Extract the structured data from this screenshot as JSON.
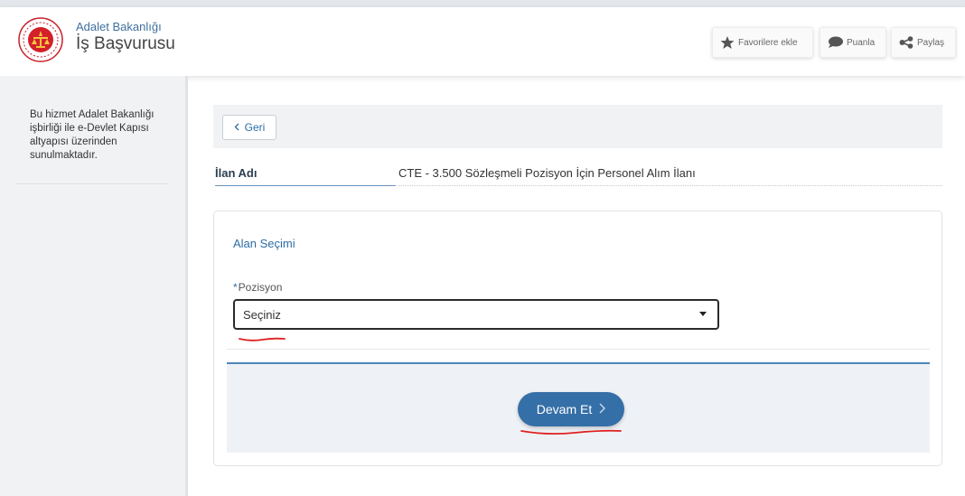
{
  "header": {
    "org_name": "Adalet Bakanlığı",
    "service_name": "İş Başvurusu",
    "buttons": {
      "favorite": "Favorilere ekle",
      "rate": "Puanla",
      "share": "Paylaş"
    }
  },
  "sidebar": {
    "info_text": "Bu hizmet Adalet Bakanlığı işbirliği ile e-Devlet Kapısı altyapısı üzerinden sunulmaktadır."
  },
  "nav": {
    "back_label": "Geri"
  },
  "listing": {
    "label": "İlan Adı",
    "value": "CTE - 3.500 Sözleşmeli Pozisyon İçin Personel Alım İlanı"
  },
  "form": {
    "section_title": "Alan Seçimi",
    "required_mark": "*",
    "position_label": "Pozisyon",
    "position_selected": "Seçiniz",
    "continue_label": "Devam Et"
  },
  "colors": {
    "accent": "#2e6da4",
    "button": "#356fa7",
    "annotation": "#e02020"
  },
  "icons": {
    "logo": "ministry-seal-icon",
    "favorite": "star-icon",
    "rate": "speech-bubble-icon",
    "share": "share-icon",
    "back": "chevron-left-icon",
    "select": "caret-down-icon",
    "continue": "chevron-right-icon"
  }
}
